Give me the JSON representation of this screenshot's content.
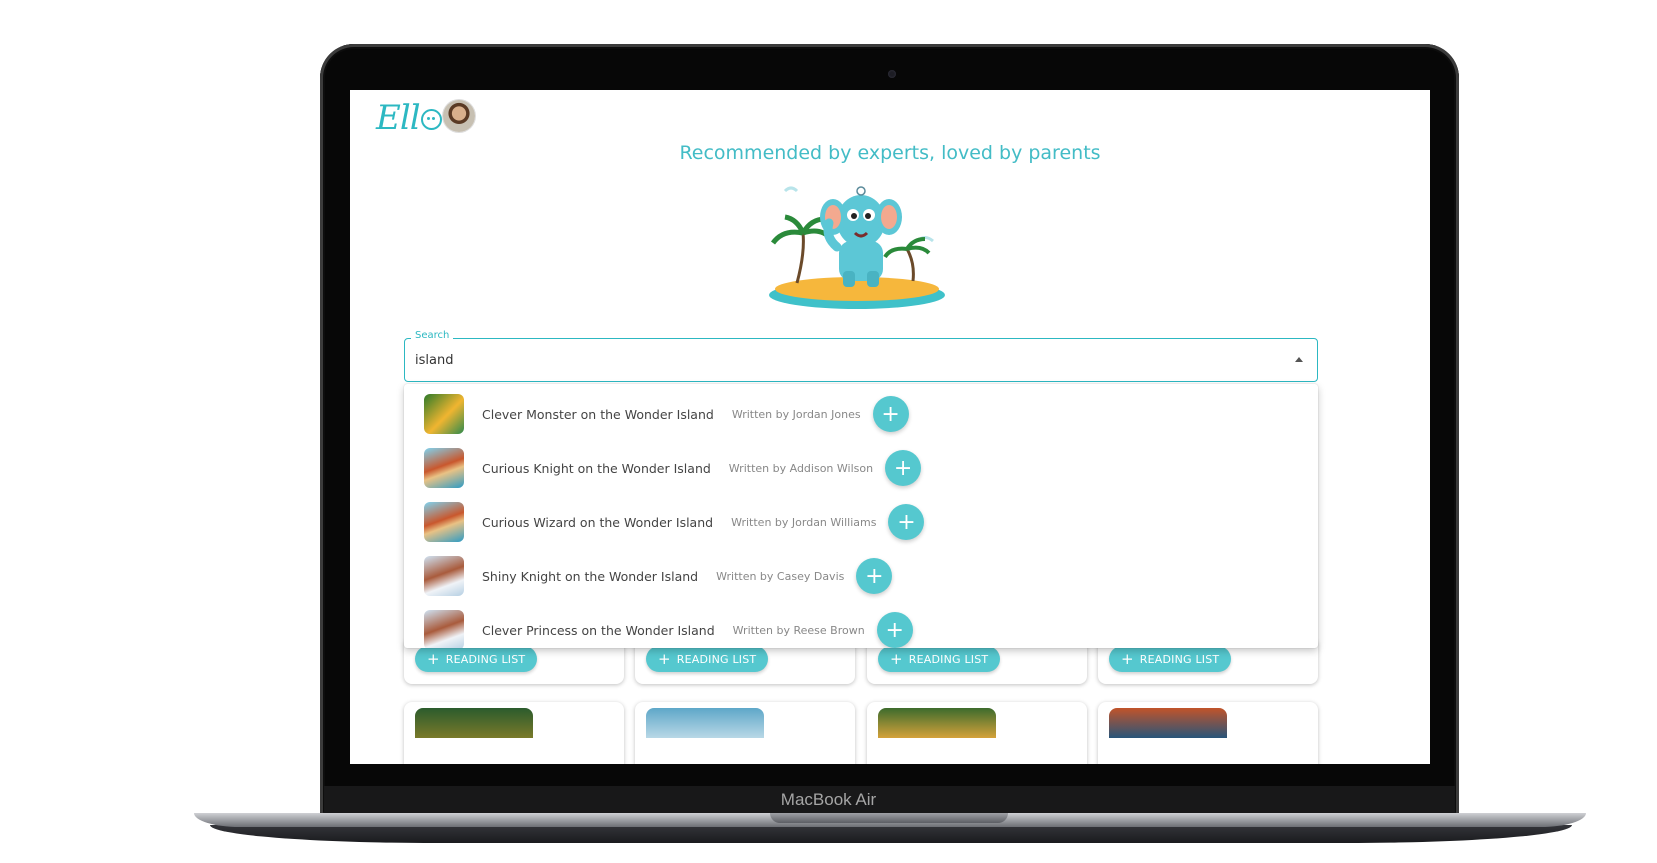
{
  "device": {
    "label": "MacBook Air"
  },
  "app": {
    "logo": "Ello",
    "headline": "Recommended by experts, loved by parents"
  },
  "search": {
    "label": "Search",
    "value": "island"
  },
  "results": [
    {
      "title": "Clever Monster on the Wonder Island",
      "author": "Written by Jordan Jones"
    },
    {
      "title": "Curious Knight on the Wonder Island",
      "author": "Written by Addison Wilson"
    },
    {
      "title": "Curious Wizard on the Wonder Island",
      "author": "Written by Jordan Williams"
    },
    {
      "title": "Shiny Knight on the Wonder Island",
      "author": "Written by Casey Davis"
    },
    {
      "title": "Clever Princess on the Wonder Island",
      "author": "Written by Reese Brown"
    }
  ],
  "icons": {
    "add": "plus-icon",
    "collapse": "arrow-up-icon"
  },
  "add_symbol": "+",
  "reading_list_label": "READING LIST",
  "colors": {
    "accent": "#2cb8c2",
    "button": "#55c8cf"
  }
}
